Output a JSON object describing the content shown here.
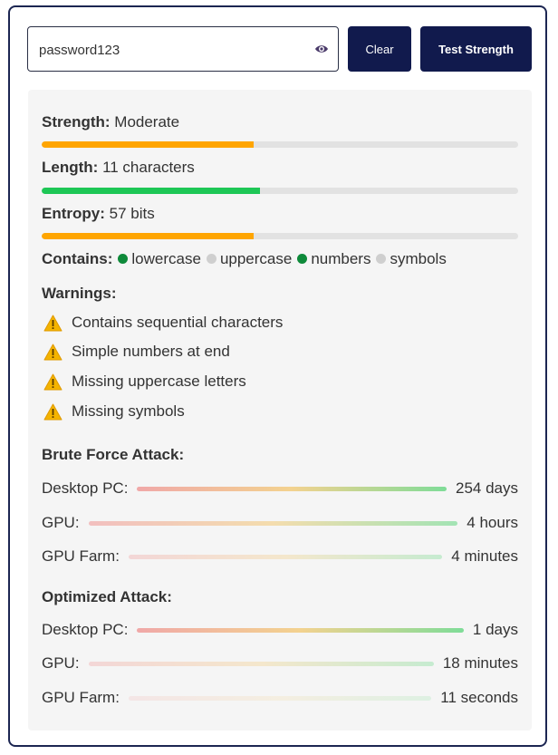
{
  "input": {
    "value": "password123",
    "placeholder": ""
  },
  "buttons": {
    "clear": "Clear",
    "test": "Test Strength"
  },
  "strength": {
    "label": "Strength:",
    "value": "Moderate",
    "fill": 0.445,
    "color": "#ffa500"
  },
  "length": {
    "label": "Length:",
    "value": "11 characters",
    "fill": 0.458,
    "color": "#1ec756"
  },
  "entropy": {
    "label": "Entropy:",
    "value": "57 bits",
    "fill": 0.445,
    "color": "#ffa500"
  },
  "contains": {
    "label": "Contains:",
    "items": [
      {
        "name": "lowercase",
        "present": true
      },
      {
        "name": "uppercase",
        "present": false
      },
      {
        "name": "numbers",
        "present": true
      },
      {
        "name": "symbols",
        "present": false
      }
    ],
    "present_color": "#0e8a3a",
    "absent_color": "#cfcfcf"
  },
  "warnings": {
    "title": "Warnings:",
    "icon": "warning-icon",
    "items": [
      "Contains sequential characters",
      "Simple numbers at end",
      "Missing uppercase letters",
      "Missing symbols"
    ]
  },
  "brute_force": {
    "title": "Brute Force Attack:",
    "rows": [
      {
        "label": "Desktop PC:",
        "value": "254 days",
        "opacity": 1.0
      },
      {
        "label": "GPU:",
        "value": "4 hours",
        "opacity": 0.7
      },
      {
        "label": "GPU Farm:",
        "value": "4 minutes",
        "opacity": 0.4
      }
    ]
  },
  "optimized": {
    "title": "Optimized Attack:",
    "rows": [
      {
        "label": "Desktop PC:",
        "value": "1 days",
        "opacity": 1.0
      },
      {
        "label": "GPU:",
        "value": "18 minutes",
        "opacity": 0.4
      },
      {
        "label": "GPU Farm:",
        "value": "11 seconds",
        "opacity": 0.2
      }
    ]
  }
}
